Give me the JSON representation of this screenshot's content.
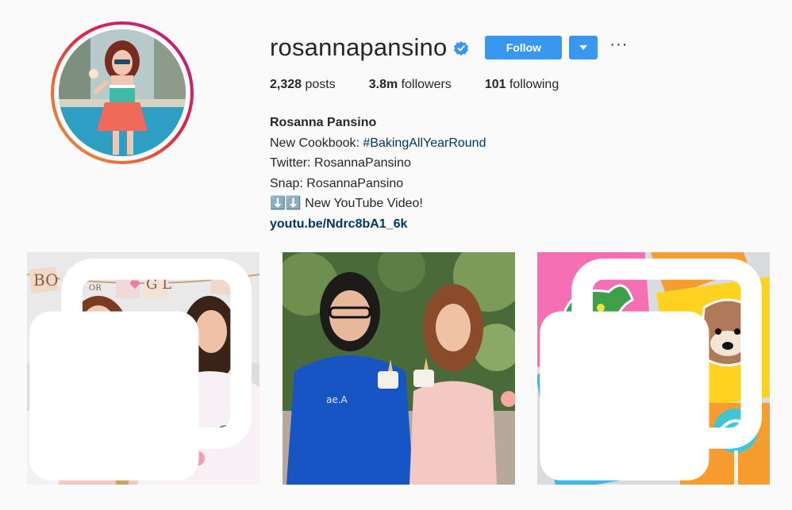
{
  "profile": {
    "username": "rosannapansino",
    "verified": true,
    "follow_label": "Follow",
    "more_label": "···",
    "stats": {
      "posts_count": "2,328",
      "posts_label": "posts",
      "followers_count": "3.8m",
      "followers_label": "followers",
      "following_count": "101",
      "following_label": "following"
    },
    "bio": {
      "full_name": "Rosanna Pansino",
      "line1_prefix": "New Cookbook: ",
      "line1_hashtag": "#BakingAllYearRound",
      "line2": "Twitter: RosannaPansino",
      "line3": "Snap: RosannaPansino",
      "line4": "⬇️⬇️ New YouTube Video!",
      "link": "youtu.be/Ndrc8bA1_6k"
    }
  },
  "posts": [
    {
      "id": "post-1",
      "multi": true,
      "banner_left": "BO",
      "banner_mid": "OR",
      "banner_right": "G  L"
    },
    {
      "id": "post-2",
      "multi": false
    },
    {
      "id": "post-3",
      "multi": true
    }
  ],
  "colors": {
    "accent": "#3897f0",
    "link": "#003569",
    "text": "#262626",
    "background": "#fafafa"
  },
  "icons": [
    "verified-badge-icon",
    "chevron-down-icon",
    "more-options-icon",
    "multiple-photos-icon"
  ]
}
